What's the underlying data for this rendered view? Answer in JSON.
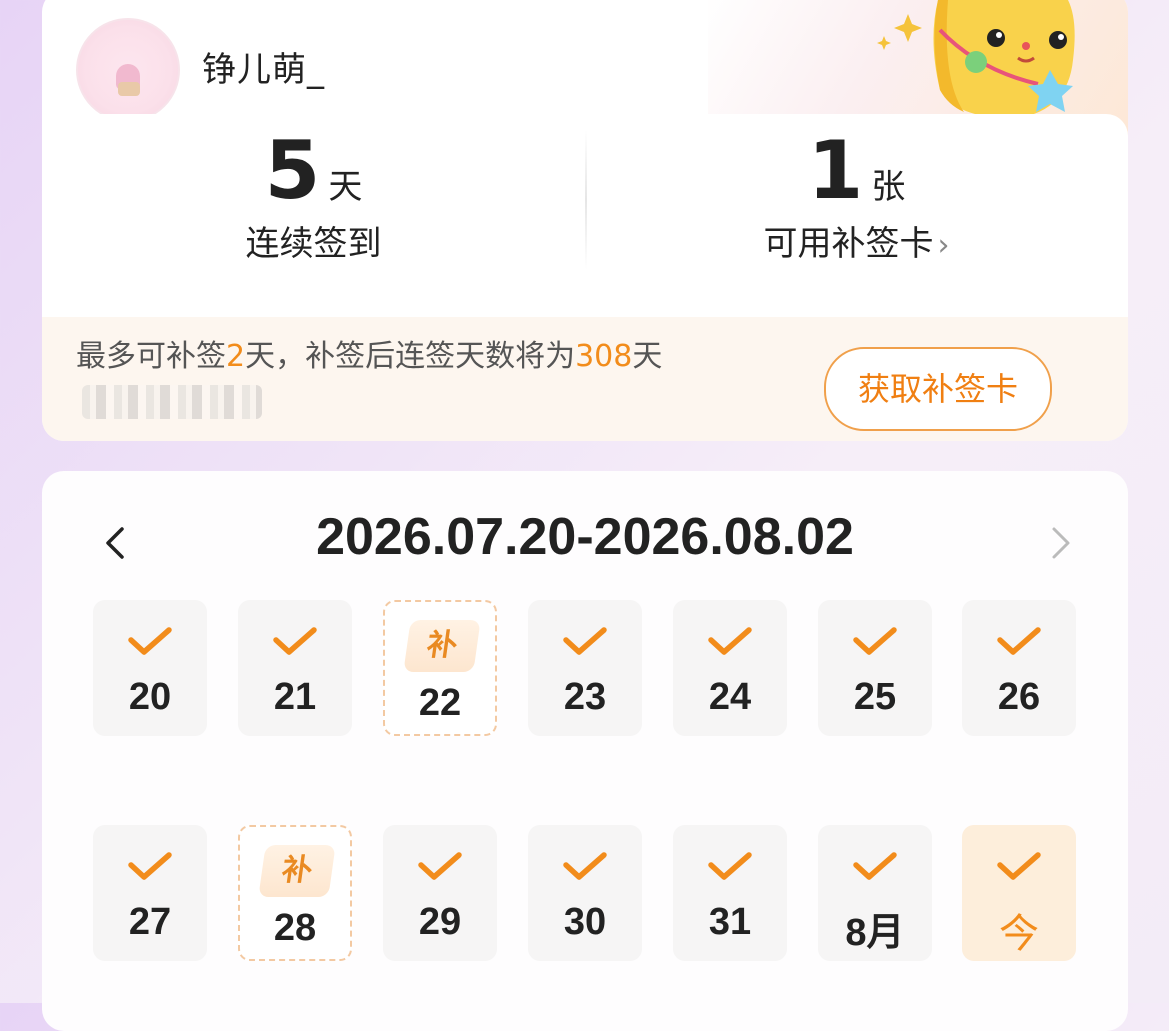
{
  "profile": {
    "username": "铮儿萌_"
  },
  "stats": {
    "streak": {
      "value": "5",
      "unit": "天",
      "label": "连续签到"
    },
    "cards": {
      "value": "1",
      "unit": "张",
      "label": "可用补签卡",
      "chevron": "›"
    }
  },
  "makeup": {
    "text_prefix": "最多可补签",
    "days": "2",
    "text_mid": "天，补签后连签天数将为",
    "result": "308",
    "text_suffix": "天",
    "button_label": "获取补签卡"
  },
  "calendar": {
    "range": "2026.07.20-2026.08.02",
    "makeup_tag": "补",
    "days": [
      {
        "label": "20",
        "state": "checked"
      },
      {
        "label": "21",
        "state": "checked"
      },
      {
        "label": "22",
        "state": "makeup"
      },
      {
        "label": "23",
        "state": "checked"
      },
      {
        "label": "24",
        "state": "checked"
      },
      {
        "label": "25",
        "state": "checked"
      },
      {
        "label": "26",
        "state": "checked"
      },
      {
        "label": "27",
        "state": "checked"
      },
      {
        "label": "28",
        "state": "makeup"
      },
      {
        "label": "29",
        "state": "checked"
      },
      {
        "label": "30",
        "state": "checked"
      },
      {
        "label": "31",
        "state": "checked"
      },
      {
        "label": "8月",
        "state": "checked"
      },
      {
        "label": "今",
        "state": "today"
      }
    ]
  },
  "colors": {
    "accent": "#f28c1b",
    "makeup_border": "#f3c9a2",
    "today_bg": "#fdeedb"
  }
}
